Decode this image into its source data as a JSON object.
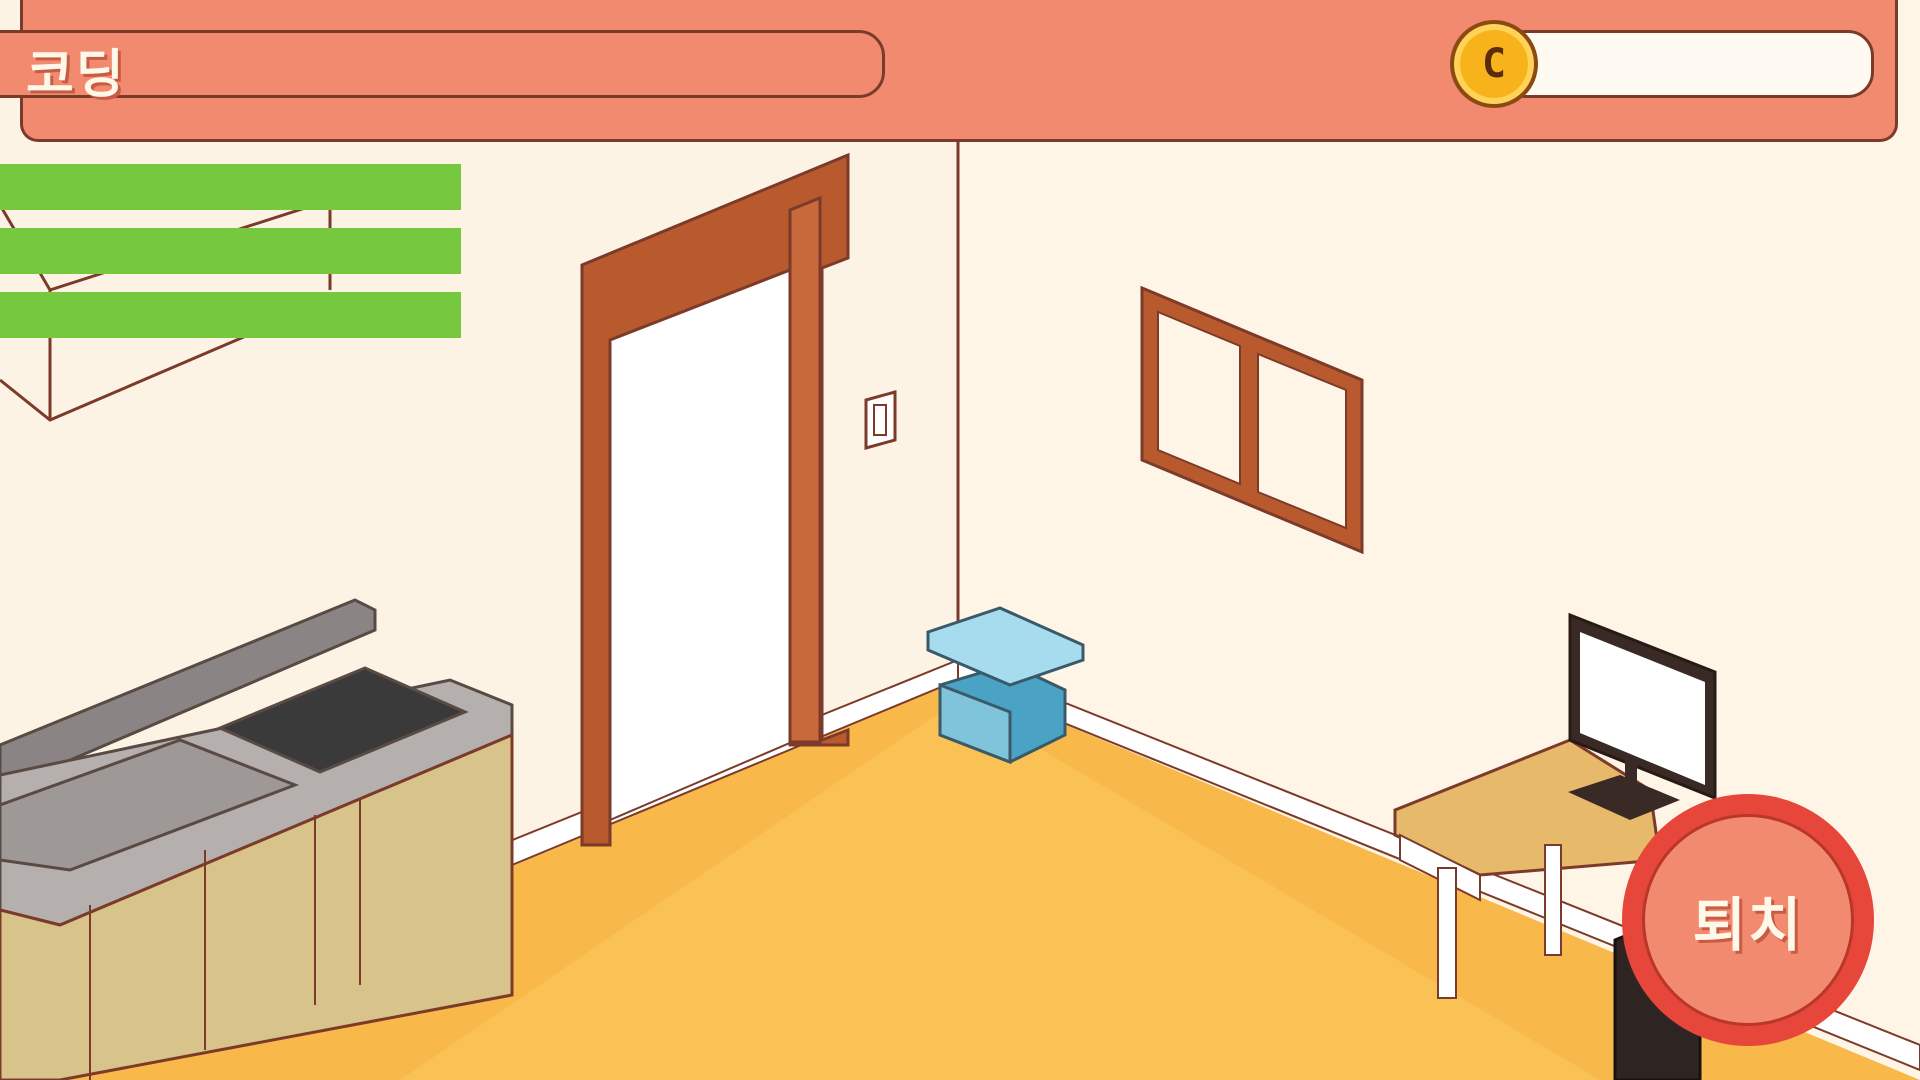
{
  "hud": {
    "activity_label": "코딩",
    "coin_symbol": "C",
    "coin_value": ""
  },
  "status_bars": [
    {
      "level": 1.0
    },
    {
      "level": 1.0
    },
    {
      "level": 1.0
    }
  ],
  "quit_button": {
    "label": "퇴치"
  },
  "colors": {
    "hud_bg": "#f28a70",
    "hud_border": "#7c3b2a",
    "status_fill": "#76c93f",
    "floor": "#f9b84a",
    "wall": "#fdf3e4",
    "door_frame": "#b85a2e",
    "trash_bin": "#4aa3c4",
    "quit_ring": "#e6473a"
  },
  "icons": [
    "coin-icon"
  ]
}
